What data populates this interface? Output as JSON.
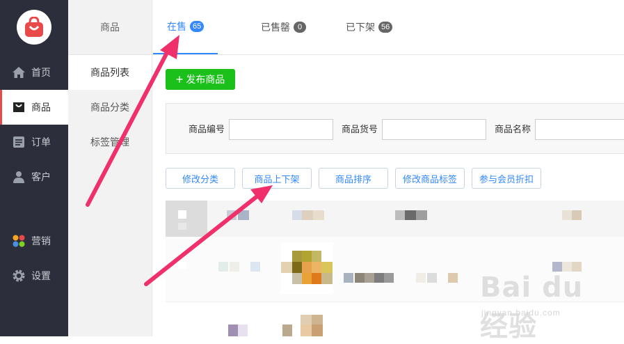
{
  "sidebar": {
    "items": [
      {
        "label": "首页",
        "icon": "home-icon"
      },
      {
        "label": "商品",
        "icon": "shopping-bag-icon"
      },
      {
        "label": "订单",
        "icon": "order-list-icon"
      },
      {
        "label": "客户",
        "icon": "user-icon"
      },
      {
        "label": "营销",
        "icon": "marketing-icon"
      },
      {
        "label": "设置",
        "icon": "gear-icon"
      }
    ],
    "accent": "#e84a4a"
  },
  "subnav": {
    "title": "商品",
    "items": [
      {
        "label": "商品列表"
      },
      {
        "label": "商品分类"
      },
      {
        "label": "标签管理"
      }
    ]
  },
  "tabs": [
    {
      "label": "在售",
      "count": "65"
    },
    {
      "label": "已售罄",
      "count": "0"
    },
    {
      "label": "已下架",
      "count": "56"
    }
  ],
  "toolbar": {
    "publish_label": "发布商品",
    "publish_color": "#1bc01b"
  },
  "filters": [
    {
      "label": "商品编号",
      "value": ""
    },
    {
      "label": "商品货号",
      "value": ""
    },
    {
      "label": "商品名称",
      "value": ""
    }
  ],
  "actions": [
    {
      "label": "修改分类"
    },
    {
      "label": "商品上下架"
    },
    {
      "label": "商品排序"
    },
    {
      "label": "修改商品标签"
    },
    {
      "label": "参与会员折扣"
    }
  ],
  "colors": {
    "primary": "#3388ff",
    "annotation": "#f0306a"
  },
  "watermark": {
    "brand": "Bai du 经验",
    "url": "jingyan.baidu.com"
  }
}
